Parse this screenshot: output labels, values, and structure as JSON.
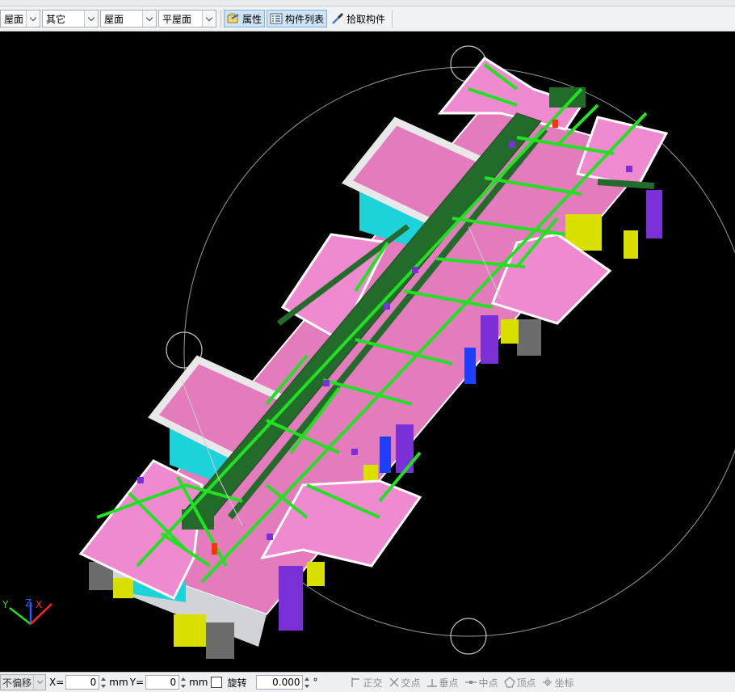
{
  "toolbar": {
    "combo1": "屋面",
    "combo2": "其它",
    "combo3": "屋面",
    "combo4": "平屋面",
    "properties_label": "属性",
    "component_list_label": "构件列表",
    "pick_component_label": "拾取构件"
  },
  "statusbar": {
    "offset_mode": "不偏移",
    "x_label": "X=",
    "x_value": "0",
    "x_unit": "mm",
    "y_label": "Y=",
    "y_value": "0",
    "y_unit": "mm",
    "rotate_label": "旋转",
    "angle_value": "0.000",
    "angle_unit": "°",
    "snaps": [
      "正交",
      "交点",
      "垂点",
      "中点",
      "顶点",
      "坐标"
    ]
  },
  "viewport": {
    "background": "#000000",
    "roof_color": "#f08ad0",
    "slab_color": "#e47bbd",
    "beam_color": "#22e022",
    "dark_beam_color": "#236b2a",
    "wall_color": "#1dd3da",
    "column_color": "#6c6c6c",
    "window_color": "#d9e000",
    "axis_labels": [
      "Y",
      "Z",
      "X"
    ]
  }
}
